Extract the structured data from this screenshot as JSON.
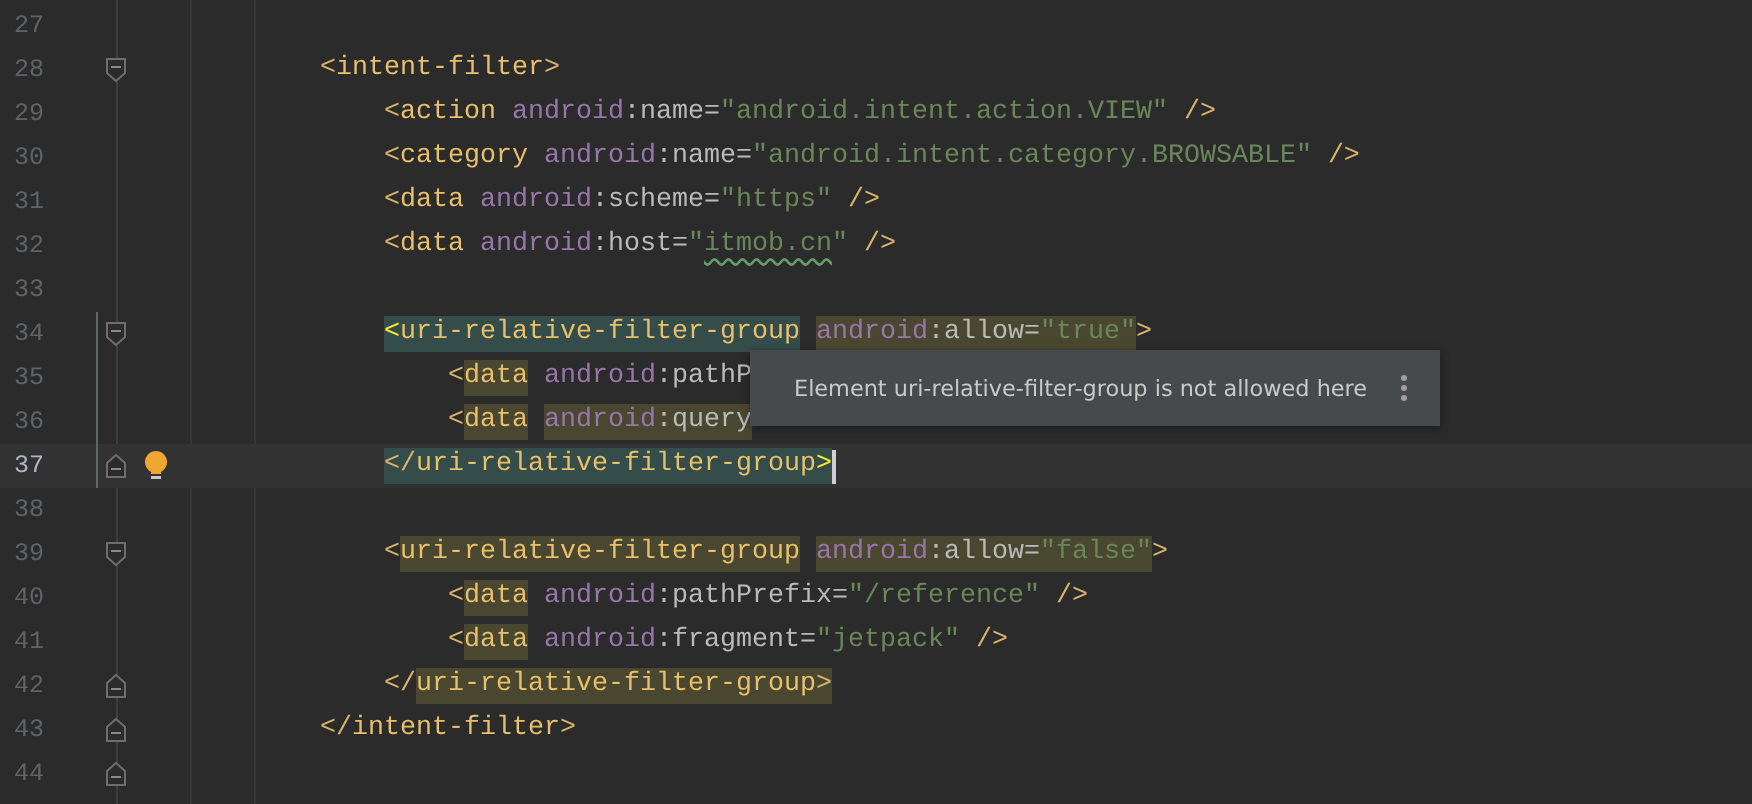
{
  "editor": {
    "lines": [
      {
        "number": "27",
        "current": false
      },
      {
        "number": "28",
        "current": false,
        "fold_open": true,
        "tokens": [
          {
            "text": "<",
            "kind": "br"
          },
          {
            "text": "intent-filter",
            "kind": "tag"
          },
          {
            "text": ">",
            "kind": "br"
          }
        ],
        "children": [
          {
            "number": "29",
            "current": false,
            "tokens": [
              {
                "text": "<",
                "kind": "br"
              },
              {
                "text": "action",
                "kind": "tag"
              },
              {
                "text": "android",
                "kind": "ns"
              },
              {
                "text": ":name",
                "kind": "attr"
              },
              {
                "text": "=",
                "kind": "eq"
              },
              {
                "text": "\"android.intent.action.VIEW\"",
                "kind": "str"
              },
              {
                "text": "/>",
                "kind": "close"
              }
            ]
          },
          {
            "number": "30",
            "current": false,
            "tokens": [
              {
                "text": "<",
                "kind": "br"
              },
              {
                "text": "category",
                "kind": "tag"
              },
              {
                "text": "android",
                "kind": "ns"
              },
              {
                "text": ":name",
                "kind": "attr"
              },
              {
                "text": "=",
                "kind": "eq"
              },
              {
                "text": "\"android.intent.category.BROWSABLE\"",
                "kind": "str"
              },
              {
                "text": "/>",
                "kind": "close"
              }
            ]
          },
          {
            "number": "31",
            "current": false,
            "tokens": [
              {
                "text": "<",
                "kind": "br"
              },
              {
                "text": "data",
                "kind": "tag"
              },
              {
                "text": "android",
                "kind": "ns"
              },
              {
                "text": ":scheme",
                "kind": "attr"
              },
              {
                "text": "=",
                "kind": "eq"
              },
              {
                "text": "\"https\"",
                "kind": "str"
              },
              {
                "text": "/>",
                "kind": "close"
              }
            ]
          },
          {
            "number": "32",
            "current": false,
            "tokens": [
              {
                "text": "<",
                "kind": "br"
              },
              {
                "text": "data",
                "kind": "tag"
              },
              {
                "text": "android",
                "kind": "ns"
              },
              {
                "text": ":host",
                "kind": "attr"
              },
              {
                "text": "=",
                "kind": "eq"
              },
              {
                "text": "\"",
                "kind": "str"
              },
              {
                "text": "itmob.cn",
                "kind": "str",
                "typo": true
              },
              {
                "text": "\"",
                "kind": "str"
              },
              {
                "text": "/>",
                "kind": "close"
              }
            ]
          },
          {
            "number": "33",
            "current": false
          },
          {
            "number": "34",
            "current": false,
            "changed": true,
            "fold_open": true,
            "tokens": [
              {
                "text": "<",
                "kind": "brace",
                "matched": true
              },
              {
                "text": "uri-relative-filter-group",
                "kind": "tag",
                "matched": true
              },
              {
                "text": "android",
                "kind": "ns",
                "used": true
              },
              {
                "text": ":allow",
                "kind": "attr",
                "used": true
              },
              {
                "text": "=",
                "kind": "eq",
                "used": true
              },
              {
                "text": "\"true\"",
                "kind": "str",
                "used": true
              },
              {
                "text": ">",
                "kind": "br"
              }
            ],
            "children": [
              {
                "number": "35",
                "current": false,
                "changed": true,
                "tokens": [
                  {
                    "text": "<",
                    "kind": "br"
                  },
                  {
                    "text": "data",
                    "kind": "tag",
                    "used": true
                  },
                  {
                    "text": "android",
                    "kind": "ns"
                  },
                  {
                    "text": ":pathP",
                    "kind": "attr"
                  }
                ]
              },
              {
                "number": "36",
                "current": false,
                "changed": true,
                "tokens": [
                  {
                    "text": "<",
                    "kind": "br"
                  },
                  {
                    "text": "data",
                    "kind": "tag",
                    "used": true
                  },
                  {
                    "text": "android",
                    "kind": "ns",
                    "used": true
                  },
                  {
                    "text": ":query",
                    "kind": "attr",
                    "used": true
                  }
                ]
              }
            ]
          },
          {
            "number": "37",
            "current": true,
            "changed": true,
            "fold_close": true,
            "bulb": true,
            "caret": true,
            "tokens": [
              {
                "text": "</",
                "kind": "br",
                "matched": true
              },
              {
                "text": "uri-relative-filter-group",
                "kind": "tag",
                "matched": true
              },
              {
                "text": ">",
                "kind": "brace",
                "matched": true
              }
            ]
          },
          {
            "number": "38",
            "current": false
          },
          {
            "number": "39",
            "current": false,
            "fold_open": true,
            "tokens": [
              {
                "text": "<",
                "kind": "br"
              },
              {
                "text": "uri-relative-filter-group",
                "kind": "tag",
                "used": true
              },
              {
                "text": "android",
                "kind": "ns",
                "used": true
              },
              {
                "text": ":allow",
                "kind": "attr",
                "used": true
              },
              {
                "text": "=",
                "kind": "eq",
                "used": true
              },
              {
                "text": "\"false\"",
                "kind": "str",
                "used": true
              },
              {
                "text": ">",
                "kind": "br"
              }
            ],
            "children": [
              {
                "number": "40",
                "current": false,
                "tokens": [
                  {
                    "text": "<",
                    "kind": "br"
                  },
                  {
                    "text": "data",
                    "kind": "tag",
                    "used": true
                  },
                  {
                    "text": "android",
                    "kind": "ns"
                  },
                  {
                    "text": ":pathPrefix",
                    "kind": "attr"
                  },
                  {
                    "text": "=",
                    "kind": "eq"
                  },
                  {
                    "text": "\"/reference\"",
                    "kind": "str"
                  },
                  {
                    "text": "/>",
                    "kind": "close"
                  }
                ]
              },
              {
                "number": "41",
                "current": false,
                "tokens": [
                  {
                    "text": "<",
                    "kind": "br"
                  },
                  {
                    "text": "data",
                    "kind": "tag",
                    "used": true
                  },
                  {
                    "text": "android",
                    "kind": "ns"
                  },
                  {
                    "text": ":fragment",
                    "kind": "attr"
                  },
                  {
                    "text": "=",
                    "kind": "eq"
                  },
                  {
                    "text": "\"jetpack\"",
                    "kind": "str"
                  },
                  {
                    "text": "/>",
                    "kind": "close"
                  }
                ]
              }
            ]
          },
          {
            "number": "42",
            "current": false,
            "fold_close": true,
            "tokens": [
              {
                "text": "</",
                "kind": "br"
              },
              {
                "text": "uri-relative-filter-group",
                "kind": "tag",
                "used": true
              },
              {
                "text": ">",
                "kind": "br",
                "used": true
              }
            ]
          }
        ]
      },
      {
        "number": "43",
        "current": false,
        "fold_close": true,
        "tokens": [
          {
            "text": "</",
            "kind": "br"
          },
          {
            "text": "intent-filter",
            "kind": "tag"
          },
          {
            "text": ">",
            "kind": "br"
          }
        ]
      },
      {
        "number": "44",
        "current": false,
        "fold_close": true
      }
    ]
  },
  "tooltip": {
    "text": "Element uri-relative-filter-group is not allowed here"
  }
}
